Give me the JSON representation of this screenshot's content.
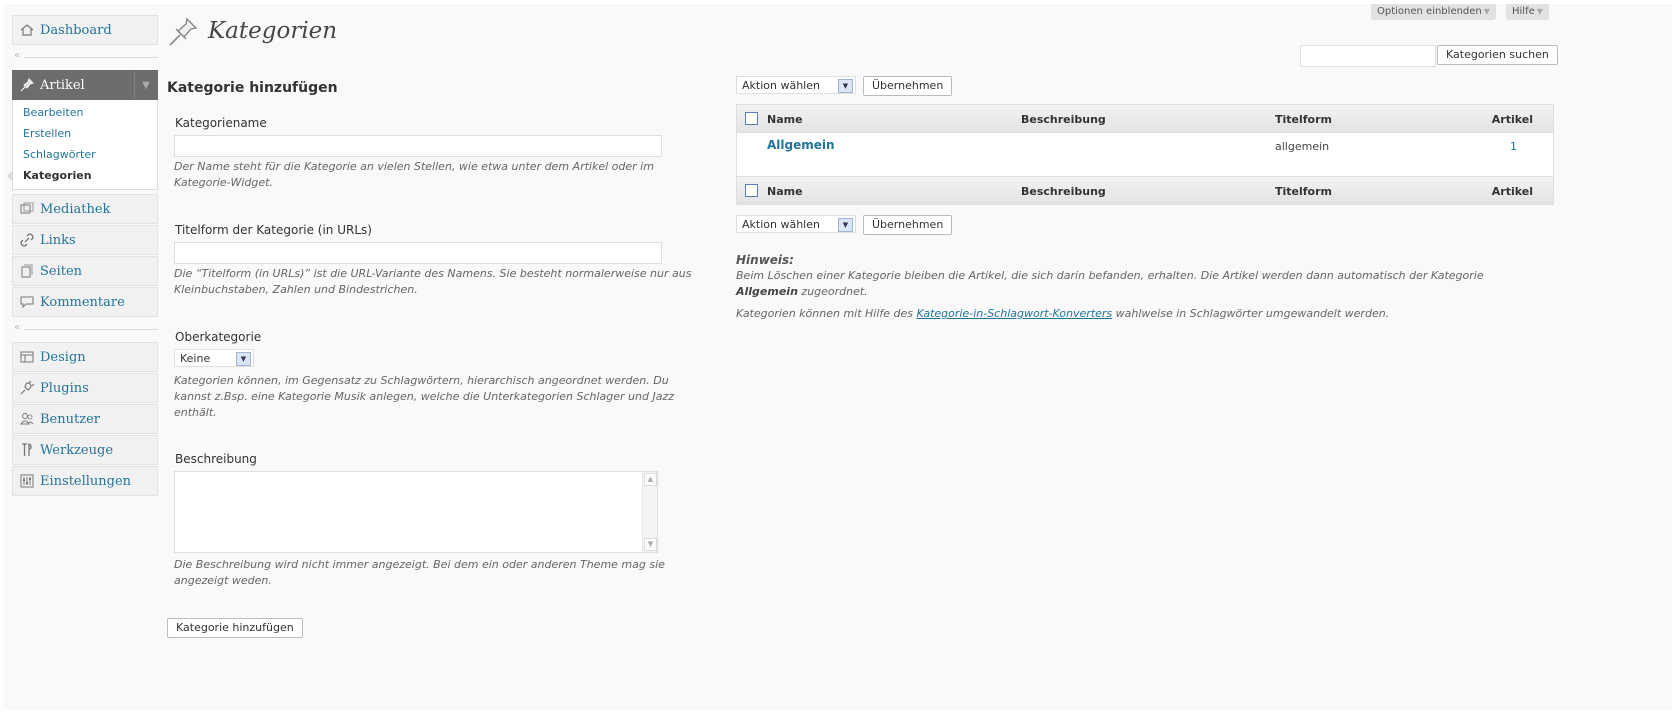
{
  "screen_tabs": {
    "options": "Optionen einblenden",
    "help": "Hilfe"
  },
  "page": {
    "title": "Kategorien"
  },
  "sidebar": {
    "dashboard": "Dashboard",
    "artikel": "Artikel",
    "submenu": [
      "Bearbeiten",
      "Erstellen",
      "Schlagwörter",
      "Kategorien"
    ],
    "items_group1": [
      "Mediathek",
      "Links",
      "Seiten",
      "Kommentare"
    ],
    "items_group2": [
      "Design",
      "Plugins",
      "Benutzer",
      "Werkzeuge",
      "Einstellungen"
    ]
  },
  "form": {
    "title": "Kategorie hinzufügen",
    "name_label": "Kategoriename",
    "name_value": "",
    "name_help": "Der Name steht für die Kategorie an vielen Stellen, wie etwa unter dem Artikel oder im Kategorie-Widget.",
    "slug_label": "Titelform der Kategorie (in URLs)",
    "slug_value": "",
    "slug_help": "Die “Titelform (in URLs)” ist die URL-Variante des Namens. Sie besteht normalerweise nur aus Kleinbuchstaben, Zahlen und Bindestrichen.",
    "parent_label": "Oberkategorie",
    "parent_value": "Keine",
    "parent_help": "Kategorien können, im Gegensatz zu Schlagwörtern, hierarchisch angeordnet werden. Du kannst z.Bsp. eine Kategorie Musik anlegen, welche die Unterkategorien Schlager und Jazz enthält.",
    "desc_label": "Beschreibung",
    "desc_value": "",
    "desc_help": "Die Beschreibung wird nicht immer angezeigt. Bei dem ein oder anderen Theme mag sie angezeigt weden.",
    "submit": "Kategorie hinzufügen"
  },
  "search": {
    "value": "",
    "button": "Kategorien suchen"
  },
  "bulk": {
    "action": "Aktion wählen",
    "apply": "Übernehmen"
  },
  "table": {
    "columns": [
      "Name",
      "Beschreibung",
      "Titelform",
      "Artikel"
    ],
    "rows": [
      {
        "name": "Allgemein",
        "description": "",
        "slug": "allgemein",
        "count": "1"
      }
    ]
  },
  "note": {
    "title": "Hinweis:",
    "line1_a": "Beim Löschen einer Kategorie bleiben die Artikel, die sich darin befanden, erhalten. Die Artikel werden dann automatisch der Kategorie",
    "line1_b": "Allgemein",
    "line1_c": "zugeordnet.",
    "line2_a": "Kategorien können mit Hilfe des",
    "line2_link": "Kategorie-in-Schlagwort-Konverters",
    "line2_b": "wahlweise in Schlagwörter umgewandelt werden."
  }
}
